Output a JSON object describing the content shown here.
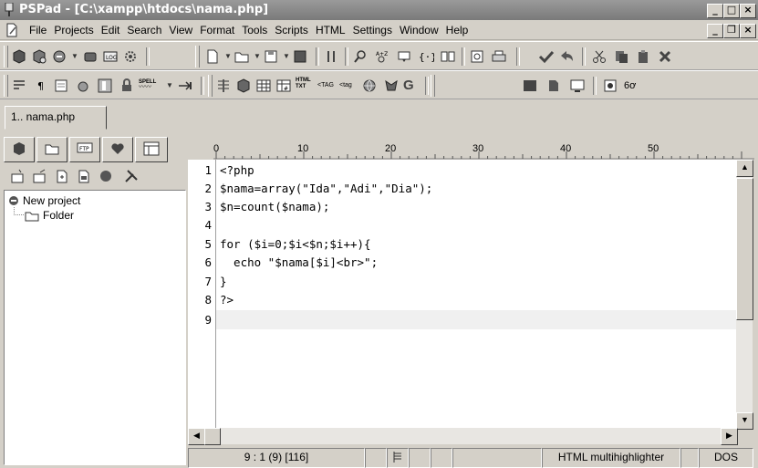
{
  "window": {
    "title": "PSPad - [C:\\xampp\\htdocs\\nama.php]"
  },
  "menu": [
    "File",
    "Projects",
    "Edit",
    "Search",
    "View",
    "Format",
    "Tools",
    "Scripts",
    "HTML",
    "Settings",
    "Window",
    "Help"
  ],
  "toolbar2_labels": {
    "spell": "SPELL",
    "html_txt_a": "HTML",
    "html_txt_b": "TXT",
    "tag_a": "TAG",
    "tag_b": "tag",
    "g": "G",
    "glasses": "6ơ"
  },
  "tabs": [
    {
      "label": "1.. nama.php"
    }
  ],
  "left_panel": {
    "tabs_icons": [
      "project-icon",
      "folder-icon",
      "ftp-icon",
      "favorites-icon",
      "clipboard-icon"
    ],
    "tree": [
      {
        "label": "New project"
      },
      {
        "label": "Folder"
      }
    ]
  },
  "ruler": {
    "marks": [
      "0",
      "10",
      "20",
      "30",
      "40",
      "50"
    ]
  },
  "editor": {
    "lines": [
      {
        "n": "1",
        "text": "<?php"
      },
      {
        "n": "2",
        "text": "$nama=array(\"Ida\",\"Adi\",\"Dia\");"
      },
      {
        "n": "3",
        "text": "$n=count($nama);"
      },
      {
        "n": "4",
        "text": ""
      },
      {
        "n": "5",
        "text": "for ($i=0;$i<$n;$i++){"
      },
      {
        "n": "6",
        "text": "  echo \"$nama[$i]<br>\";"
      },
      {
        "n": "7",
        "text": "}"
      },
      {
        "n": "8",
        "text": "?>"
      },
      {
        "n": "9",
        "text": ""
      }
    ]
  },
  "statusbar": {
    "position": "9 : 1  (9)  [116]",
    "highlighter": "HTML multihighlighter",
    "format": "DOS"
  }
}
